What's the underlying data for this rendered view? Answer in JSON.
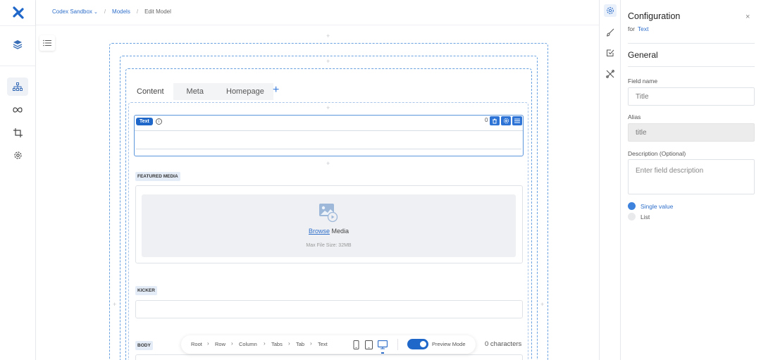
{
  "breadcrumb": {
    "workspace": "Codex Sandbox",
    "models": "Models",
    "current": "Edit Model"
  },
  "tabs": [
    "Content",
    "Meta",
    "Homepage"
  ],
  "tab_add": "+",
  "selected_field": {
    "badge": "Text",
    "info": "i",
    "count": "0"
  },
  "featured_media": {
    "label": "FEATURED MEDIA",
    "browse_link": "Browse",
    "browse_rest": " Media",
    "max_size": "Max File Size: 32MB"
  },
  "kicker": {
    "label": "KICKER"
  },
  "body_field": {
    "label": "BODY"
  },
  "bottom_bar": {
    "path": [
      "Root",
      "Row",
      "Column",
      "Tabs",
      "Tab",
      "Text"
    ],
    "preview_label": "Preview Mode",
    "preview_on": true,
    "char_count": "0 characters"
  },
  "config": {
    "title": "Configuration",
    "for_label": "for",
    "for_value": "Text",
    "close": "×",
    "section": "General",
    "field_name_label": "Field name",
    "field_name_value": "Title",
    "alias_label": "Alias",
    "alias_value": "title",
    "description_label": "Description (Optional)",
    "description_placeholder": "Enter field description",
    "options": [
      "Single value",
      "List"
    ],
    "selected_option": "Single value"
  },
  "colors": {
    "accent": "#1f67c9",
    "link": "#2f6fca",
    "dashed": "#6aa1e0"
  },
  "icons": {
    "left_rail": [
      "layers-icon",
      "sitemap-icon",
      "infinity-icon",
      "crop-icon",
      "settings-icon"
    ],
    "right_rail": [
      "gear-icon",
      "brush-icon",
      "check-square-icon",
      "tools-icon"
    ],
    "devices": [
      "mobile-icon",
      "tablet-icon",
      "desktop-icon"
    ],
    "field_toolbar": [
      "trash-icon",
      "gear-icon",
      "menu-icon"
    ]
  }
}
